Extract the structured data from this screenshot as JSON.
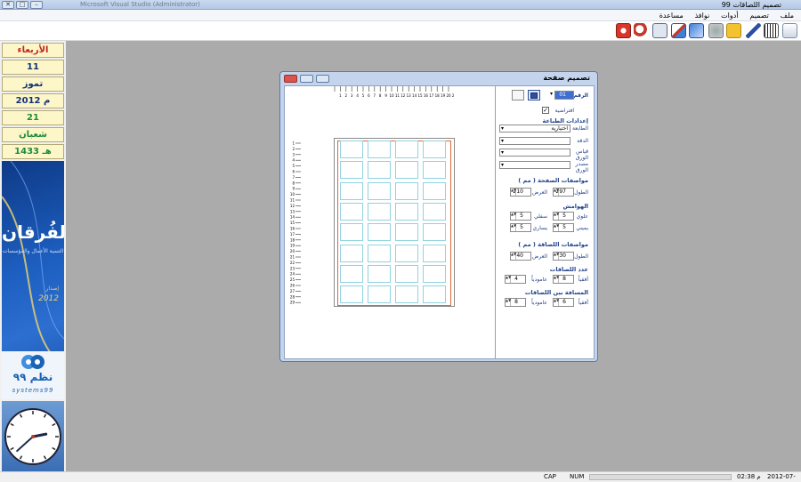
{
  "window": {
    "title": "تصميم اللصاقات 99",
    "subtitle": "Microsoft Visual Studio (Administrator)"
  },
  "menu": [
    "ملف",
    "تصميم",
    "أدوات",
    "نوافذ",
    "مساعدة"
  ],
  "toolbar_icons": [
    "new-doc-icon",
    "open-icon",
    "barcode-icon",
    "pen-icon",
    "folder-icon",
    "attach-icon",
    "database-icon",
    "edit-icon",
    "card-icon",
    "calculator-icon",
    "search-zoom-icon",
    "power-icon"
  ],
  "date_panel": {
    "day_name": "الأربعاء",
    "day": "11",
    "month": "تموز",
    "year": "2012 م",
    "hijri_day": "21",
    "hijri_month": "شعبان",
    "hijri_year": "1433 هـ"
  },
  "banner": {
    "brand": "الفُرقان",
    "sub": "التنمية الأعمال والمؤسسات",
    "year_label": "إصدار",
    "year": "2012"
  },
  "logo": {
    "name": "نظم ٩٩",
    "en": "systems99"
  },
  "clock": {
    "hour": 2,
    "minute": 38
  },
  "status": {
    "caps": "CAP",
    "num": "NUM",
    "time": "02:38 م",
    "date": "2012-07-11"
  },
  "dialog": {
    "title": "تصميم صفحة",
    "code_label": "الرقم",
    "code_value": "01",
    "default_label": "افتراضية",
    "default_checked": true,
    "printer_settings": "إعدادات الطباعة",
    "printer_label": "الطابعة",
    "printer_value": "اختيارية",
    "quality_label": "الدقة",
    "paper_size_label": "قياس الورق",
    "paper_source_label": "مصدر الورق",
    "page_spec": "مواصفات الصفحة ( مم )",
    "height_label": "الطول",
    "width_label": "العرض",
    "page_height": "297",
    "page_width": "210",
    "margins_label": "الهوامش",
    "top_label": "علوي",
    "bottom_label": "سفلي",
    "right_label": "يميني",
    "left_label": "يساري",
    "margin_top": "5",
    "margin_bottom": "5",
    "margin_right": "5",
    "margin_left": "5",
    "label_spec": "مواصفات اللصاقة ( مم )",
    "label_height": "30",
    "label_width": "40",
    "count_label": "عدد اللصاقات",
    "horizontal_label": "أفقياً",
    "vertical_label": "عامودياً",
    "count_h": "8",
    "count_v": "4",
    "spacing_label": "المسافة بين اللصاقات",
    "space_h": "6",
    "space_v": "8",
    "ruler_h": [
      "1",
      "2",
      "3",
      "4",
      "5",
      "6",
      "7",
      "8",
      "9",
      "10",
      "11",
      "12",
      "13",
      "14",
      "15",
      "16",
      "17",
      "18",
      "19",
      "20",
      "21"
    ],
    "ruler_v": [
      "1",
      "2",
      "3",
      "4",
      "5",
      "6",
      "7",
      "8",
      "9",
      "10",
      "11",
      "12",
      "13",
      "14",
      "15",
      "16",
      "17",
      "18",
      "19",
      "20",
      "21",
      "22",
      "23",
      "24",
      "25",
      "26",
      "27",
      "28",
      "29"
    ],
    "grid": {
      "columns": 4,
      "rows": 8
    }
  },
  "colors": {
    "accent": "#1f3f8a",
    "margin_line": "#e0673c",
    "label_border": "#8fd3e0",
    "date_box": "#fdf6c8"
  }
}
